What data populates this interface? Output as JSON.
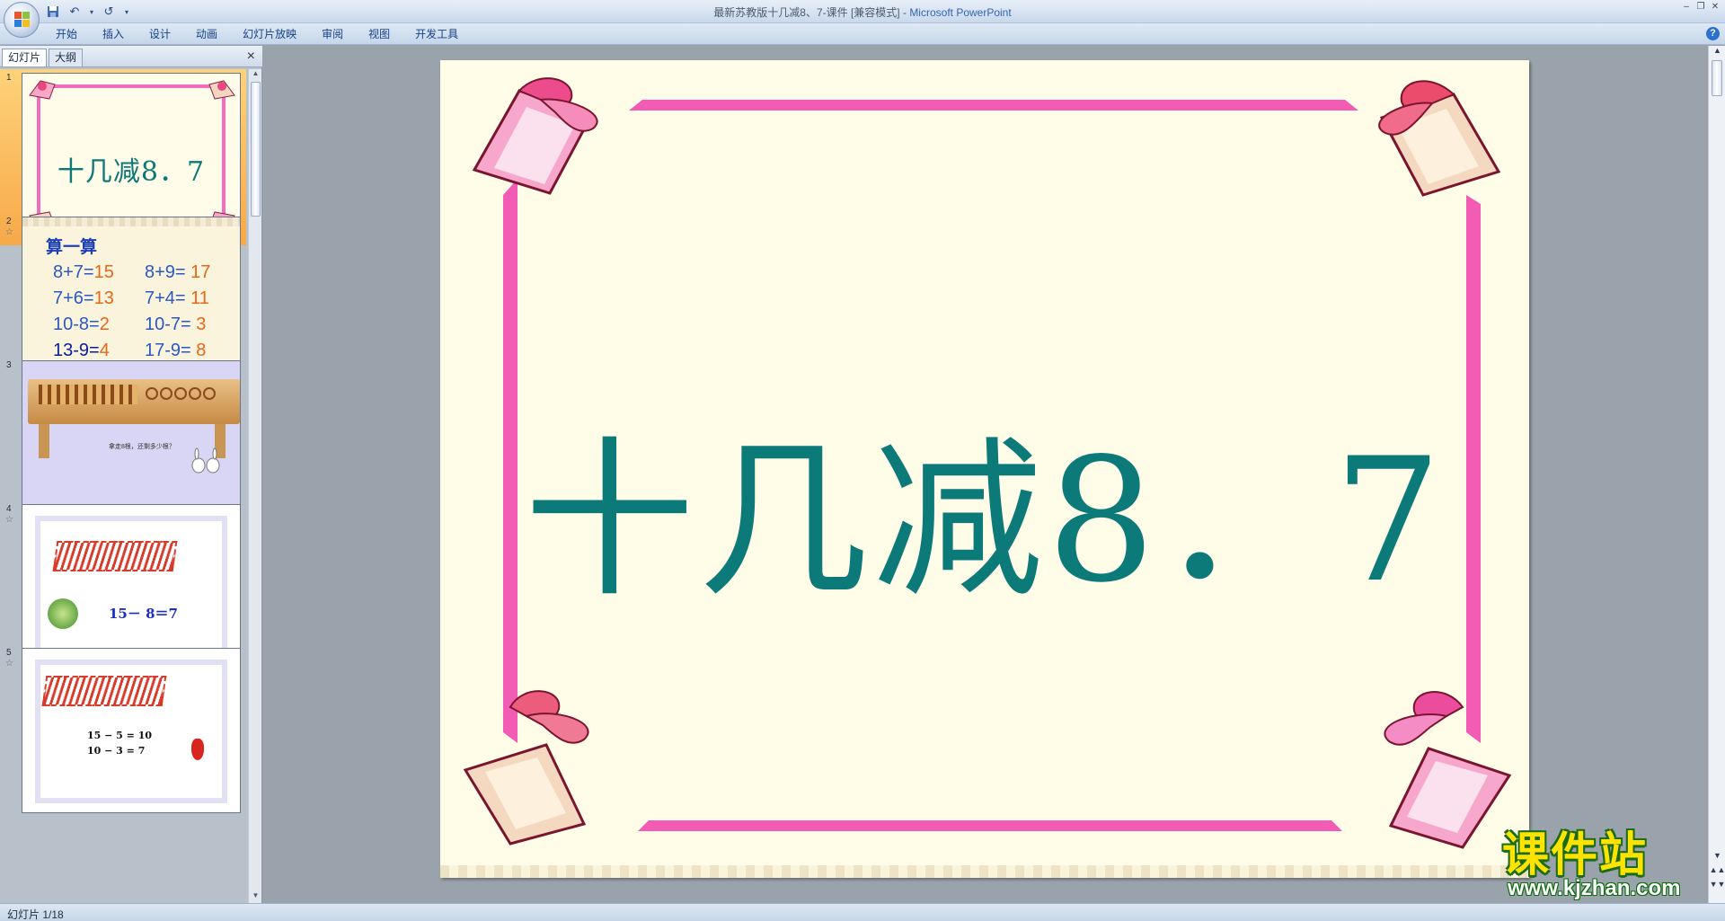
{
  "window": {
    "title": "最新苏教版十几减8、7-课件 [兼容模式] - ",
    "app_name": "Microsoft PowerPoint",
    "qat_icons": [
      "save-icon",
      "undo-icon",
      "redo-icon",
      "customize-icon"
    ],
    "controls": [
      "minimize",
      "restore",
      "close"
    ]
  },
  "ribbon": {
    "tabs": [
      {
        "label": "开始"
      },
      {
        "label": "插入"
      },
      {
        "label": "设计"
      },
      {
        "label": "动画"
      },
      {
        "label": "幻灯片放映"
      },
      {
        "label": "审阅"
      },
      {
        "label": "视图"
      },
      {
        "label": "开发工具"
      }
    ],
    "help": "?"
  },
  "left_pane": {
    "tabs": [
      {
        "label": "幻灯片"
      },
      {
        "label": "大纲"
      }
    ],
    "close": "×",
    "slides": [
      {
        "number": "1",
        "title": "十几减8．7"
      },
      {
        "number": "2",
        "heading": "算一算",
        "rows": [
          [
            {
              "expr": "8+7=",
              "ans": "15"
            },
            {
              "expr": "8+9=",
              "ans": "17"
            }
          ],
          [
            {
              "expr": "7+6=",
              "ans": "13"
            },
            {
              "expr": "7+4=",
              "ans": "11"
            }
          ],
          [
            {
              "expr": "10-8=",
              "ans": "2"
            },
            {
              "expr": "10-7=",
              "ans": "3"
            }
          ],
          [
            {
              "expr": "13-9=",
              "ans": "4"
            },
            {
              "expr": "17-9=",
              "ans": "8"
            }
          ]
        ]
      },
      {
        "number": "3",
        "caption": "拿走8根，还剩多少根？"
      },
      {
        "number": "4",
        "equation": "15－ 8＝7"
      },
      {
        "number": "5",
        "equation_1": "15 − 5 = 10",
        "equation_2": "10 − 3 = 7"
      }
    ]
  },
  "main_slide": {
    "title": "十几减8．7",
    "title_color": "#0d7a7a",
    "frame_color": "#f35cb4",
    "background": "#fffde7"
  },
  "watermark": {
    "text": "课件站",
    "url": "www.kjzhan.com"
  },
  "status": {
    "slide_indicator": "幻灯片 1/18"
  }
}
